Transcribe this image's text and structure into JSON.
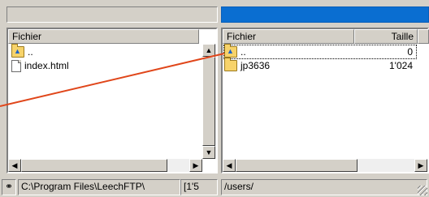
{
  "left_pane": {
    "column_header": "Fichier",
    "rows": [
      {
        "name": ".."
      },
      {
        "name": "index.html"
      }
    ]
  },
  "right_pane": {
    "column_headers": {
      "name": "Fichier",
      "size": "Taille"
    },
    "rows": [
      {
        "name": "..",
        "size": "0"
      },
      {
        "name": "jp3636",
        "size": "1'024"
      }
    ]
  },
  "status_bar": {
    "icon": "link-icon",
    "local_path": "C:\\Program Files\\LeechFTP\\",
    "local_extra": "[1'5",
    "remote_path": "/users/"
  },
  "colors": {
    "active_title": "#0a6ed1",
    "drag_line": "#e0461a"
  }
}
